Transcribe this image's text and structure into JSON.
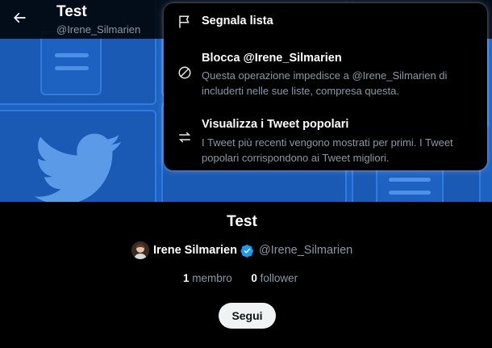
{
  "header": {
    "title": "Test",
    "handle": "@Irene_Silmarien"
  },
  "menu": {
    "items": [
      {
        "icon": "flag-icon",
        "label": "Segnala lista",
        "description": ""
      },
      {
        "icon": "block-icon",
        "label": "Blocca @Irene_Silmarien",
        "description": "Questa operazione impedisce a @Irene_Silmarien di includerti nelle sue liste, compresa questa."
      },
      {
        "icon": "swap-arrows-icon",
        "label": "Visualizza i Tweet popolari",
        "description": "I Tweet più recenti vengono mostrati per primi. I Tweet popolari corrispondono ai Tweet migliori."
      }
    ]
  },
  "list": {
    "title": "Test",
    "owner_name": "Irene Silmarien",
    "owner_handle": "@Irene_Silmarien",
    "members_count": "1",
    "members_label": "membro",
    "followers_count": "0",
    "followers_label": "follower",
    "follow_label": "Segui"
  },
  "colors": {
    "banner": "#1d62c0",
    "verified": "#1d9bf0",
    "follow_button": "#eff3f4"
  }
}
